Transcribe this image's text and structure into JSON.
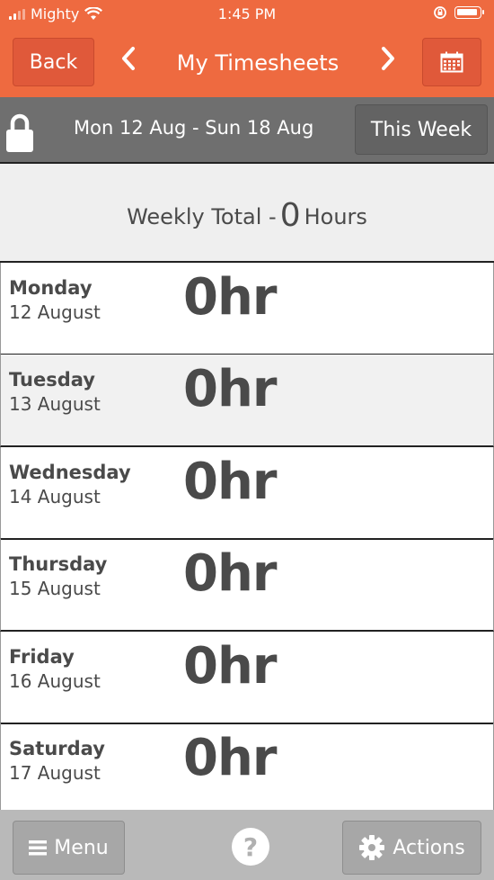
{
  "status_bar": {
    "carrier": "Mighty",
    "time": "1:45 PM"
  },
  "header": {
    "back_label": "Back",
    "title": "My Timesheets",
    "prev_icon": "chevron-left-icon",
    "next_icon": "chevron-right-icon",
    "calendar_icon": "calendar-icon",
    "accent_color": "#ee6a40"
  },
  "week_bar": {
    "range": "Mon 12 Aug - Sun 18 Aug",
    "this_week_label": "This Week",
    "lock_icon": "lock-icon"
  },
  "total": {
    "prefix": "Weekly Total - ",
    "value": "0",
    "suffix": " Hours"
  },
  "days": [
    {
      "name": "Monday",
      "date": "12 August",
      "hours": "0hr"
    },
    {
      "name": "Tuesday",
      "date": "13 August",
      "hours": "0hr"
    },
    {
      "name": "Wednesday",
      "date": "14 August",
      "hours": "0hr"
    },
    {
      "name": "Thursday",
      "date": "15 August",
      "hours": "0hr"
    },
    {
      "name": "Friday",
      "date": "16 August",
      "hours": "0hr"
    },
    {
      "name": "Saturday",
      "date": "17 August",
      "hours": "0hr"
    }
  ],
  "bottom_bar": {
    "menu_label": "Menu",
    "help_label": "?",
    "actions_label": "Actions"
  }
}
